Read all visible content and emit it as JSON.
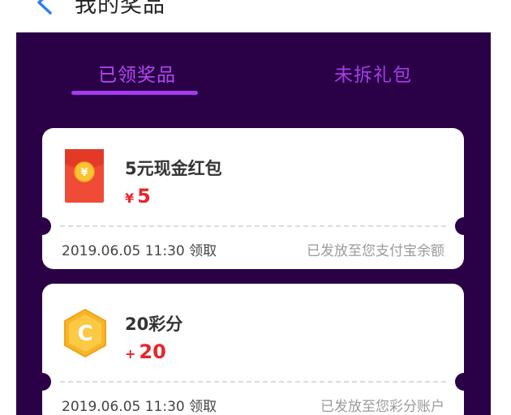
{
  "header": {
    "title": "我的奖品",
    "back_icon": "chevron-left-icon"
  },
  "tabs": [
    {
      "label": "已领奖品",
      "active": true
    },
    {
      "label": "未拆礼包",
      "active": false
    }
  ],
  "prizes": [
    {
      "icon": "red-envelope-icon",
      "icon_glyph": "¥",
      "name": "5元现金红包",
      "value_symbol": "¥",
      "value": "5",
      "claim_time": "2019.06.05 11:30 领取",
      "status": "已发放至您支付宝余额"
    },
    {
      "icon": "coin-c-icon",
      "icon_glyph": "C",
      "name": "20彩分",
      "value_symbol": "+",
      "value": "20",
      "claim_time": "2019.06.05 11:30 领取",
      "status": "已发放至您彩分账户"
    }
  ],
  "colors": {
    "panel_bg": "#2a0147",
    "accent": "#a63af0",
    "price_red": "#e8242b",
    "envelope_red": "#ef4b36",
    "coin_gold": "#f7b52c"
  }
}
